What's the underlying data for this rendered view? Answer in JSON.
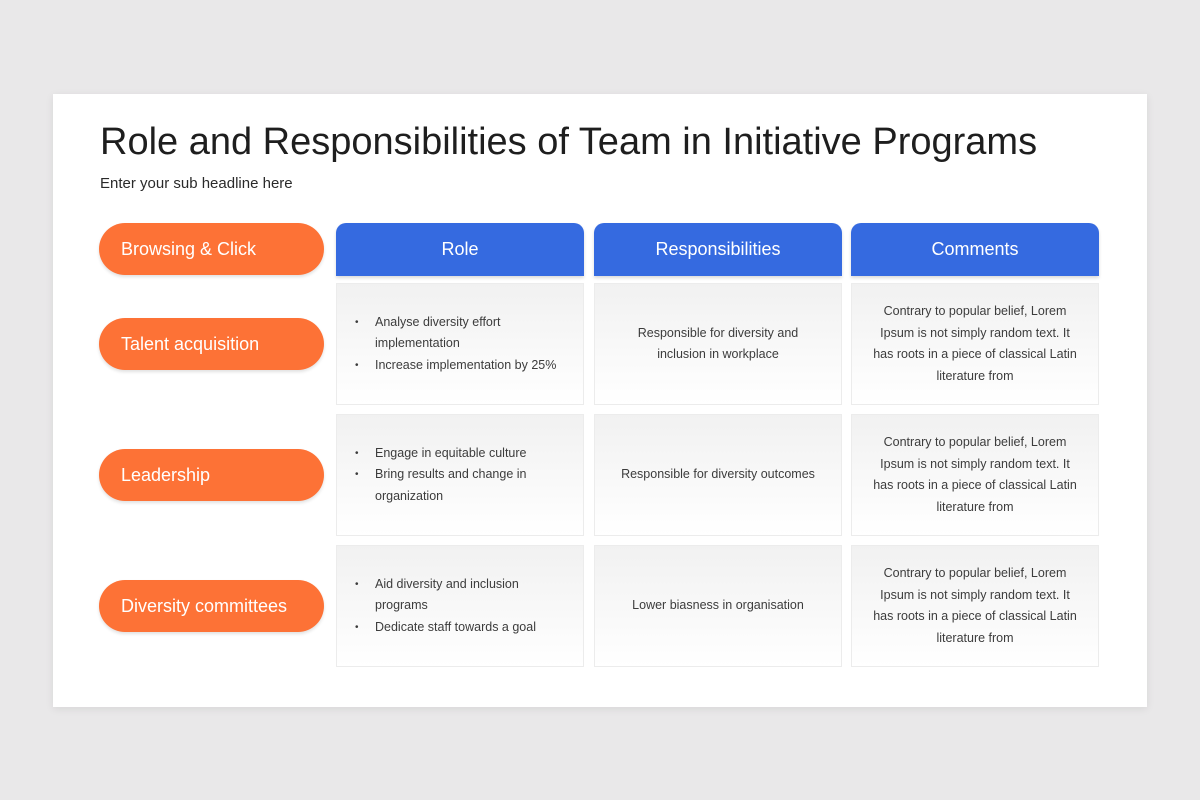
{
  "title": "Role and Responsibilities of Team in Initiative Programs",
  "subtitle": "Enter your sub headline here",
  "colors": {
    "orange": "#fd7236",
    "blue": "#356ae0",
    "background": "#e9e8e9"
  },
  "pills": {
    "corner": "Browsing & Click",
    "rows": [
      "Talent acquisition",
      "Leadership",
      "Diversity committees"
    ]
  },
  "headers": [
    "Role",
    "Responsibilities",
    "Comments"
  ],
  "rows": [
    {
      "role": [
        "Analyse diversity effort implementation",
        "Increase implementation by 25%"
      ],
      "responsibility": "Responsible for diversity and inclusion in workplace",
      "comment": "Contrary to popular belief, Lorem Ipsum is not simply random text. It has roots in a piece of classical Latin literature from"
    },
    {
      "role": [
        "Engage in equitable culture",
        "Bring results and change in organization"
      ],
      "responsibility": "Responsible for diversity outcomes",
      "comment": "Contrary to popular belief, Lorem Ipsum is not simply random text. It has roots in a piece of classical Latin literature from"
    },
    {
      "role": [
        "Aid diversity and inclusion programs",
        "Dedicate staff towards a goal"
      ],
      "responsibility": "Lower biasness in organisation",
      "comment": "Contrary to popular belief, Lorem Ipsum is not simply random text. It has roots in a piece of classical Latin literature from"
    }
  ],
  "bullet_glyph": "•"
}
